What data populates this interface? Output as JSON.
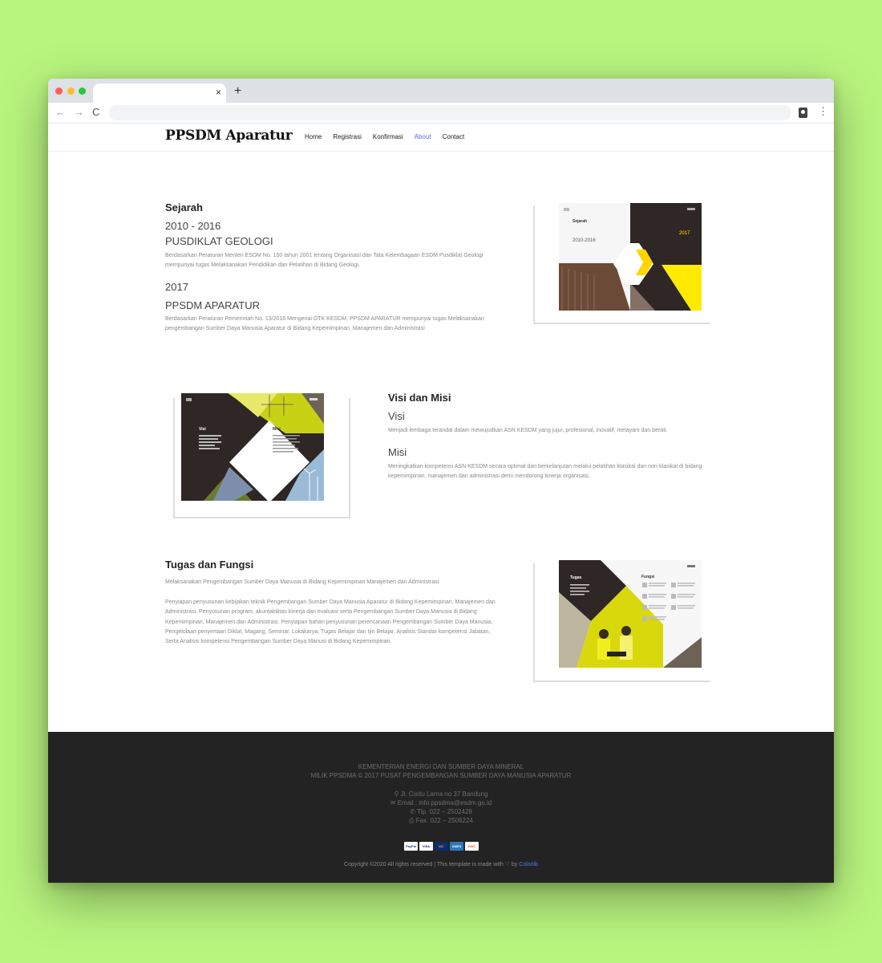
{
  "browser": {
    "tab_close": "×",
    "new_tab": "+",
    "back": "←",
    "forward": "→",
    "reload": "C",
    "menu": "⋮"
  },
  "site": {
    "logo": "PPSDM Aparatur",
    "nav": [
      "Home",
      "Registrasi",
      "Konfirmasi",
      "About",
      "Contact"
    ],
    "active_nav": "About"
  },
  "sejarah": {
    "heading": "Sejarah",
    "year1": "2010 - 2016",
    "title1": "PUSDIKLAT GEOLOGI",
    "text1": "Berdasarkan Peraturan Menteri ESDM No. 150 tahun 2001 tentang Organisasi dan Tata Kelembagaan ESDM Pusdiklat Geologi mempunyai tugas Melaksanakan Pendidikan dan Pelatihan di Bidang Geologi.",
    "year2": "2017",
    "title2": "PPSDM APARATUR",
    "text2": "Berdasarkan Peraturan Pemerintah No. 13/2016 Mengenai OTK KESDM, PPSDM APARATUR mempunyai tugas Melaksanakan pengembangan Sumber Daya Manusia Aparatur di Bidang Kepemimpinan, Manajemen dan Administrasi",
    "image": {
      "label": "Sejarah",
      "years": "2010-2016",
      "year_right": "2017"
    }
  },
  "visi_misi": {
    "heading": "Visi dan Misi",
    "visi_title": "Visi",
    "visi_text": "Menjadi lembaga terandal dalam mewujudkan ASN KESDM yang jujur, profesional, inovatif, melayani dan berati.",
    "misi_title": "Misi",
    "misi_text": "Meningkatkan kompetensi ASN KESDM secara optimal dan berkelanjutan melalui pelatihan klasikal dan non-klasikal di bidang kepemimpinan, manajemen dan administrasi demi mendorong kinerja organisasi.",
    "image": {
      "visi_label": "Visi",
      "misi_label": "Misi"
    }
  },
  "tugas": {
    "heading": "Tugas dan Fungsi",
    "text1": "Melaksanakan Pengembangan Sumber Daya Manusia di Bidang Kepemimpinan Manajemen dan Administrasi",
    "text2": "Penyiapan penyusunan kebijakan teknik Pengembangan Sumber Daya Manusia Aparatur di Bidang Kepemimpinan, Manajemen dan Administrasi. Penyusunan program, akuntabilitas kinerja dan evaluasi serta Pengembangan Sumber Daya Manusia di Bidang Kepemimpinan, Manajemen dan Administrasi. Penyiapan bahan penyusunan perencanaan Pengembangan Sumber Daya Manusia, Pengelolaan penyertaan Diklat, Magang, Seminar, Lokakarya, Tugas Belajar dan Ijin Belajar, Analisis Standar kompetensi Jabatan, Serta Analisis kompetensi Pengembangan Sumber Daya Manusi di Bidang Kepemimpinan.",
    "image": {
      "tugas_label": "Tugas",
      "fungsi_label": "Fungsi"
    }
  },
  "footer": {
    "line1": "KEMENTERIAN ENERGI DAN SUMBER DAYA MINERAL",
    "line2": "MILIK PPSDMA © 2017 PUSAT PENGEMBANGAN SUMBER DAYA MANUSIA APARATUR",
    "address": "Jl. Cisitu Lama no 37 Bandung",
    "email": "Email : info.ppsdma@esdm.go.id",
    "phone": "Tlp. 022 – 2502428",
    "fax": "Fax. 022 – 2506224",
    "address_icon": "⚲",
    "email_icon": "✉",
    "phone_icon": "✆",
    "fax_icon": "⎙",
    "cards": [
      "PayPal",
      "VISA",
      "MC",
      "AMEX",
      "DISC"
    ],
    "copyright_text": "Copyright ©2020 All rights reserved | This template is made with ♡ by",
    "copyright_brand": "Colorlib"
  },
  "colors": {
    "page_bg": "#b8f57e",
    "accent": "#5b6cd9",
    "yellow": "#ffea00",
    "dark": "#2e2725",
    "footer_bg": "#232323"
  }
}
